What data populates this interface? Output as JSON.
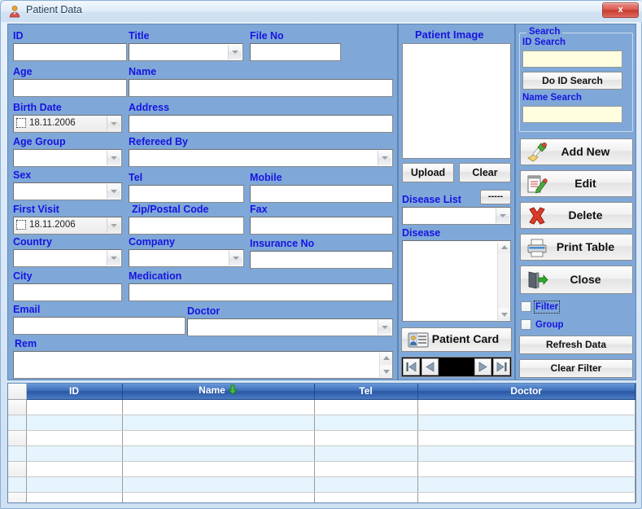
{
  "window": {
    "title": "Patient Data",
    "icon": "patient-icon",
    "close_label": "x"
  },
  "colors": {
    "panel_bg": "#7fa8d8",
    "label_blue": "#1714e0",
    "search_input": "#ffffe0",
    "grid_header": "#2a58a5",
    "grid_alt_row": "#e6f5fd",
    "close_red": "#c73b2f"
  },
  "form": {
    "fields": [
      {
        "name": "id",
        "label": "ID",
        "type": "text",
        "value": ""
      },
      {
        "name": "title",
        "label": "Title",
        "type": "combo",
        "value": ""
      },
      {
        "name": "file_no",
        "label": "File No",
        "type": "text",
        "value": ""
      },
      {
        "name": "age",
        "label": "Age",
        "type": "text",
        "value": ""
      },
      {
        "name": "patient_name",
        "label": "Name",
        "type": "text",
        "value": ""
      },
      {
        "name": "birth_date",
        "label": "Birth Date",
        "type": "date",
        "value": "18.11.2006"
      },
      {
        "name": "address",
        "label": "Address",
        "type": "text",
        "value": ""
      },
      {
        "name": "age_group",
        "label": "Age Group",
        "type": "combo",
        "value": ""
      },
      {
        "name": "refereed_by",
        "label": "Refereed By",
        "type": "combo",
        "value": ""
      },
      {
        "name": "sex",
        "label": "Sex",
        "type": "combo",
        "value": ""
      },
      {
        "name": "tel",
        "label": "Tel",
        "type": "text",
        "value": ""
      },
      {
        "name": "mobile",
        "label": "Mobile",
        "type": "text",
        "value": ""
      },
      {
        "name": "first_visit",
        "label": "First Visit",
        "type": "date",
        "value": "18.11.2006"
      },
      {
        "name": "zip_code",
        "label": "Zip/Postal Code",
        "type": "text",
        "value": ""
      },
      {
        "name": "fax",
        "label": "Fax",
        "type": "text",
        "value": ""
      },
      {
        "name": "country",
        "label": "Country",
        "type": "combo",
        "value": ""
      },
      {
        "name": "company",
        "label": "Company",
        "type": "combo",
        "value": ""
      },
      {
        "name": "insurance_no",
        "label": "Insurance No",
        "type": "text",
        "value": ""
      },
      {
        "name": "city",
        "label": "City",
        "type": "text",
        "value": ""
      },
      {
        "name": "medication",
        "label": "Medication",
        "type": "text",
        "value": ""
      },
      {
        "name": "email",
        "label": "Email",
        "type": "text",
        "value": ""
      },
      {
        "name": "doctor",
        "label": "Doctor",
        "type": "combo",
        "value": ""
      },
      {
        "name": "rem",
        "label": "Rem",
        "type": "memo",
        "value": ""
      }
    ]
  },
  "middle": {
    "patient_image_label": "Patient Image",
    "upload_label": "Upload",
    "clear_label": "Clear",
    "disease_list_label": "Disease List",
    "disease_list_value": "",
    "dots_button_label": "-----",
    "disease_label": "Disease",
    "disease_value": "",
    "patient_card_label": "Patient Card",
    "patient_card_icon": "id-card-icon",
    "nav": {
      "first_label": "first-record",
      "prev_label": "previous-record",
      "next_label": "next-record",
      "last_label": "last-record",
      "position_text": ""
    }
  },
  "search": {
    "group_title": "Search",
    "id_search_label": "ID Search",
    "id_search_value": "",
    "do_id_search_label": "Do ID Search",
    "name_search_label": "Name Search",
    "name_search_value": ""
  },
  "actions": {
    "buttons": [
      {
        "name": "add-new",
        "label": "Add New",
        "icon": "brush-icon"
      },
      {
        "name": "edit",
        "label": "Edit",
        "icon": "notepad-pencil-icon"
      },
      {
        "name": "delete",
        "label": "Delete",
        "icon": "red-x-icon"
      },
      {
        "name": "print-table",
        "label": "Print Table",
        "icon": "printer-icon"
      },
      {
        "name": "close",
        "label": "Close",
        "icon": "exit-door-icon"
      }
    ],
    "filter_label": "Filter",
    "filter_checked": false,
    "group_label": "Group",
    "group_checked": false,
    "refresh_data_label": "Refresh Data",
    "clear_filter_label": "Clear Filter"
  },
  "grid": {
    "columns": [
      "ID",
      "Name",
      "Tel",
      "Doctor"
    ],
    "sorted_column": "Name",
    "sort_direction": "desc",
    "rows": [
      [
        "",
        "",
        "",
        ""
      ],
      [
        "",
        "",
        "",
        ""
      ],
      [
        "",
        "",
        "",
        ""
      ],
      [
        "",
        "",
        "",
        ""
      ],
      [
        "",
        "",
        "",
        ""
      ],
      [
        "",
        "",
        "",
        ""
      ],
      [
        "",
        "",
        "",
        ""
      ]
    ]
  }
}
